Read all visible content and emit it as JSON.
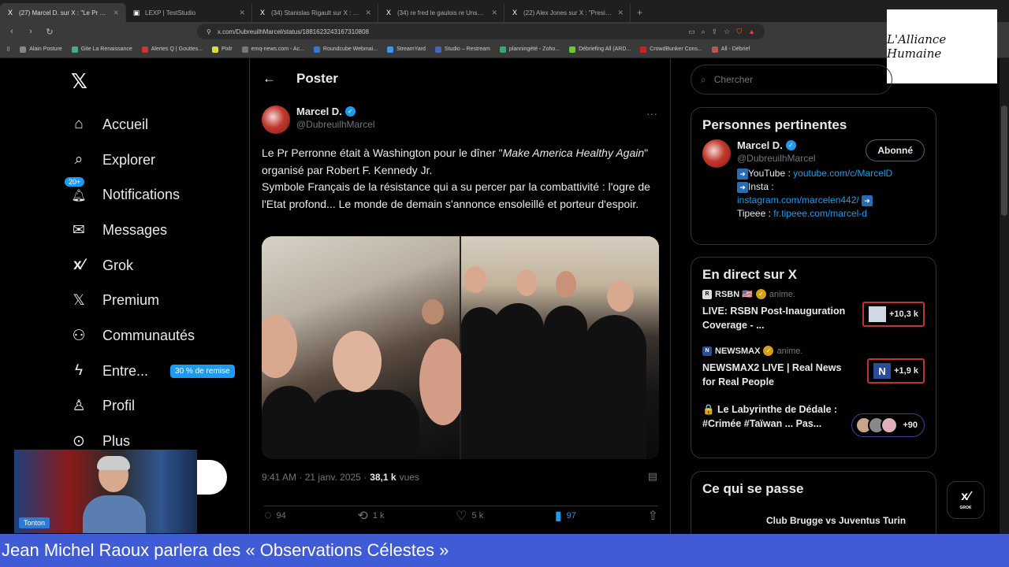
{
  "browser": {
    "tabs": [
      {
        "title": "(27) Marcel D. sur X : \"Le Pr Per",
        "icon": "X",
        "active": true
      },
      {
        "title": "LEXP | TestStudio",
        "icon": "▣",
        "active": false
      },
      {
        "title": "(34) Stanislas Rigault sur X : \"La gau",
        "icon": "X",
        "active": false
      },
      {
        "title": "(34) re fred le gaulois re Unsondesi",
        "icon": "X",
        "active": false
      },
      {
        "title": "(22) Alex Jones sur X : \"President Tr",
        "icon": "X",
        "active": false
      }
    ],
    "url": "x.com/DubreuilhMarcel/status/1881623243167310808",
    "bookmarks": [
      "Alain Posture",
      "Gite La Renaissance",
      "Alertes Q | Gouttes...",
      "Pixlr",
      "emq-news.com - Ac...",
      "Roundcube Webmai...",
      "StreamYard",
      "Studio – Restream",
      "planningété - Zoho...",
      "Débriefing All (ARD...",
      "CrowdBunker Cons...",
      "All - Débrief"
    ]
  },
  "overlay_logo": "L'Alliance Humaine",
  "sidebar": {
    "items": [
      {
        "label": "Accueil",
        "icon": "home-icon",
        "glyph": "⌂"
      },
      {
        "label": "Explorer",
        "icon": "search-icon",
        "glyph": "⌕"
      },
      {
        "label": "Notifications",
        "icon": "bell-icon",
        "glyph": "🔔",
        "badge": "20+"
      },
      {
        "label": "Messages",
        "icon": "mail-icon",
        "glyph": "✉"
      },
      {
        "label": "Grok",
        "icon": "grok-icon",
        "glyph": "⁄"
      },
      {
        "label": "Premium",
        "icon": "x-premium-icon",
        "glyph": "X"
      },
      {
        "label": "Communautés",
        "icon": "communities-icon",
        "glyph": "⚇"
      },
      {
        "label": "Entre...",
        "icon": "lightning-icon",
        "glyph": "ϟ",
        "promo": "30 % de remise"
      },
      {
        "label": "Profil",
        "icon": "person-icon",
        "glyph": "♙"
      },
      {
        "label": "Plus",
        "icon": "more-circle-icon",
        "glyph": "⋯"
      }
    ]
  },
  "main": {
    "header": "Poster",
    "author": {
      "name": "Marcel D.",
      "handle": "@DubreuilhMarcel"
    },
    "text": {
      "part1": "Le Pr Perronne était à Washington pour le dîner \"",
      "italic": "Make America Healthy Again",
      "part2": "\" organisé par Robert F. Kennedy Jr.",
      "line2": "Symbole Français de la résistance qui a su percer par la combattivité : l'ogre de l'Etat profond... Le monde de demain s'annonce ensoleillé et porteur d'espoir."
    },
    "meta": {
      "time": "9:41 AM · 21 janv. 2025 · ",
      "views_count": "38,1 k",
      "views_label": " vues"
    },
    "actions": {
      "replies": "94",
      "reposts": "1 k",
      "likes": "5 k",
      "bookmarks": "97"
    }
  },
  "right": {
    "search_placeholder": "Chercher",
    "relevant": {
      "title": "Personnes pertinentes",
      "name": "Marcel D.",
      "handle": "@DubreuilhMarcel",
      "follow_label": "Abonné",
      "bio_youtube_label": "YouTube : ",
      "bio_youtube_link": "youtube.com/c/MarcelD",
      "bio_insta_label": "Insta :",
      "bio_insta_link": "instagram.com/marcelen442/",
      "bio_tipeee_label": "Tipeee : ",
      "bio_tipeee_link": "fr.tipeee.com/marcel-d"
    },
    "live": {
      "title": "En direct sur X",
      "items": [
        {
          "host": "RSBN 🇺🇸",
          "status": "anime.",
          "title": "LIVE: RSBN Post-Inauguration Coverage - ...",
          "count": "+10,3 k"
        },
        {
          "host": "NEWSMAX",
          "status": "anime.",
          "title": "NEWSMAX2 LIVE | Real News for Real People",
          "count": "+1,9 k"
        },
        {
          "host": "",
          "status": "",
          "title": "🔒 Le Labyrinthe de Dédale : #Crimée #Taïwan ... Pas...",
          "count": "+90"
        }
      ]
    },
    "happening": {
      "title": "Ce qui se passe",
      "item": "Club Brugge vs Juventus Turin"
    }
  },
  "grok_button": {
    "label": "GROK"
  },
  "webcam": {
    "name_label": "Tonton"
  },
  "ticker": "Jean Michel Raoux parlera des « Observations Célestes »"
}
